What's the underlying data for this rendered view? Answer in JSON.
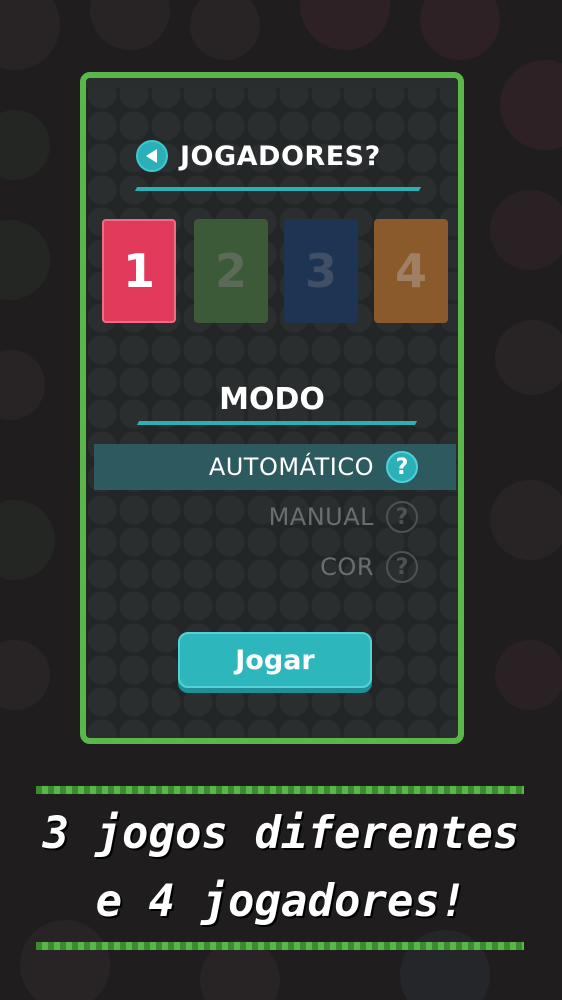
{
  "header": {
    "back_icon": "back-arrow-icon",
    "title": "JOGADORES?"
  },
  "players": {
    "options": [
      "1",
      "2",
      "3",
      "4"
    ],
    "selected": "1",
    "colors": [
      "#e23a5b",
      "#3c5a37",
      "#1e3453",
      "#8a5a2a"
    ]
  },
  "mode": {
    "title": "MODO",
    "options": [
      {
        "label": "AUTOMÁTICO",
        "help": "?"
      },
      {
        "label": "MANUAL",
        "help": "?"
      },
      {
        "label": "COR",
        "help": "?"
      }
    ],
    "selected": "AUTOMÁTICO"
  },
  "play_button": {
    "label": "Jogar"
  },
  "promo": {
    "line1": "3 jogos diferentes",
    "line2": "e 4 jogadores!"
  },
  "colors": {
    "accent": "#2bb0b8",
    "frame": "#5ab84a",
    "background": "#1f1d1e"
  }
}
